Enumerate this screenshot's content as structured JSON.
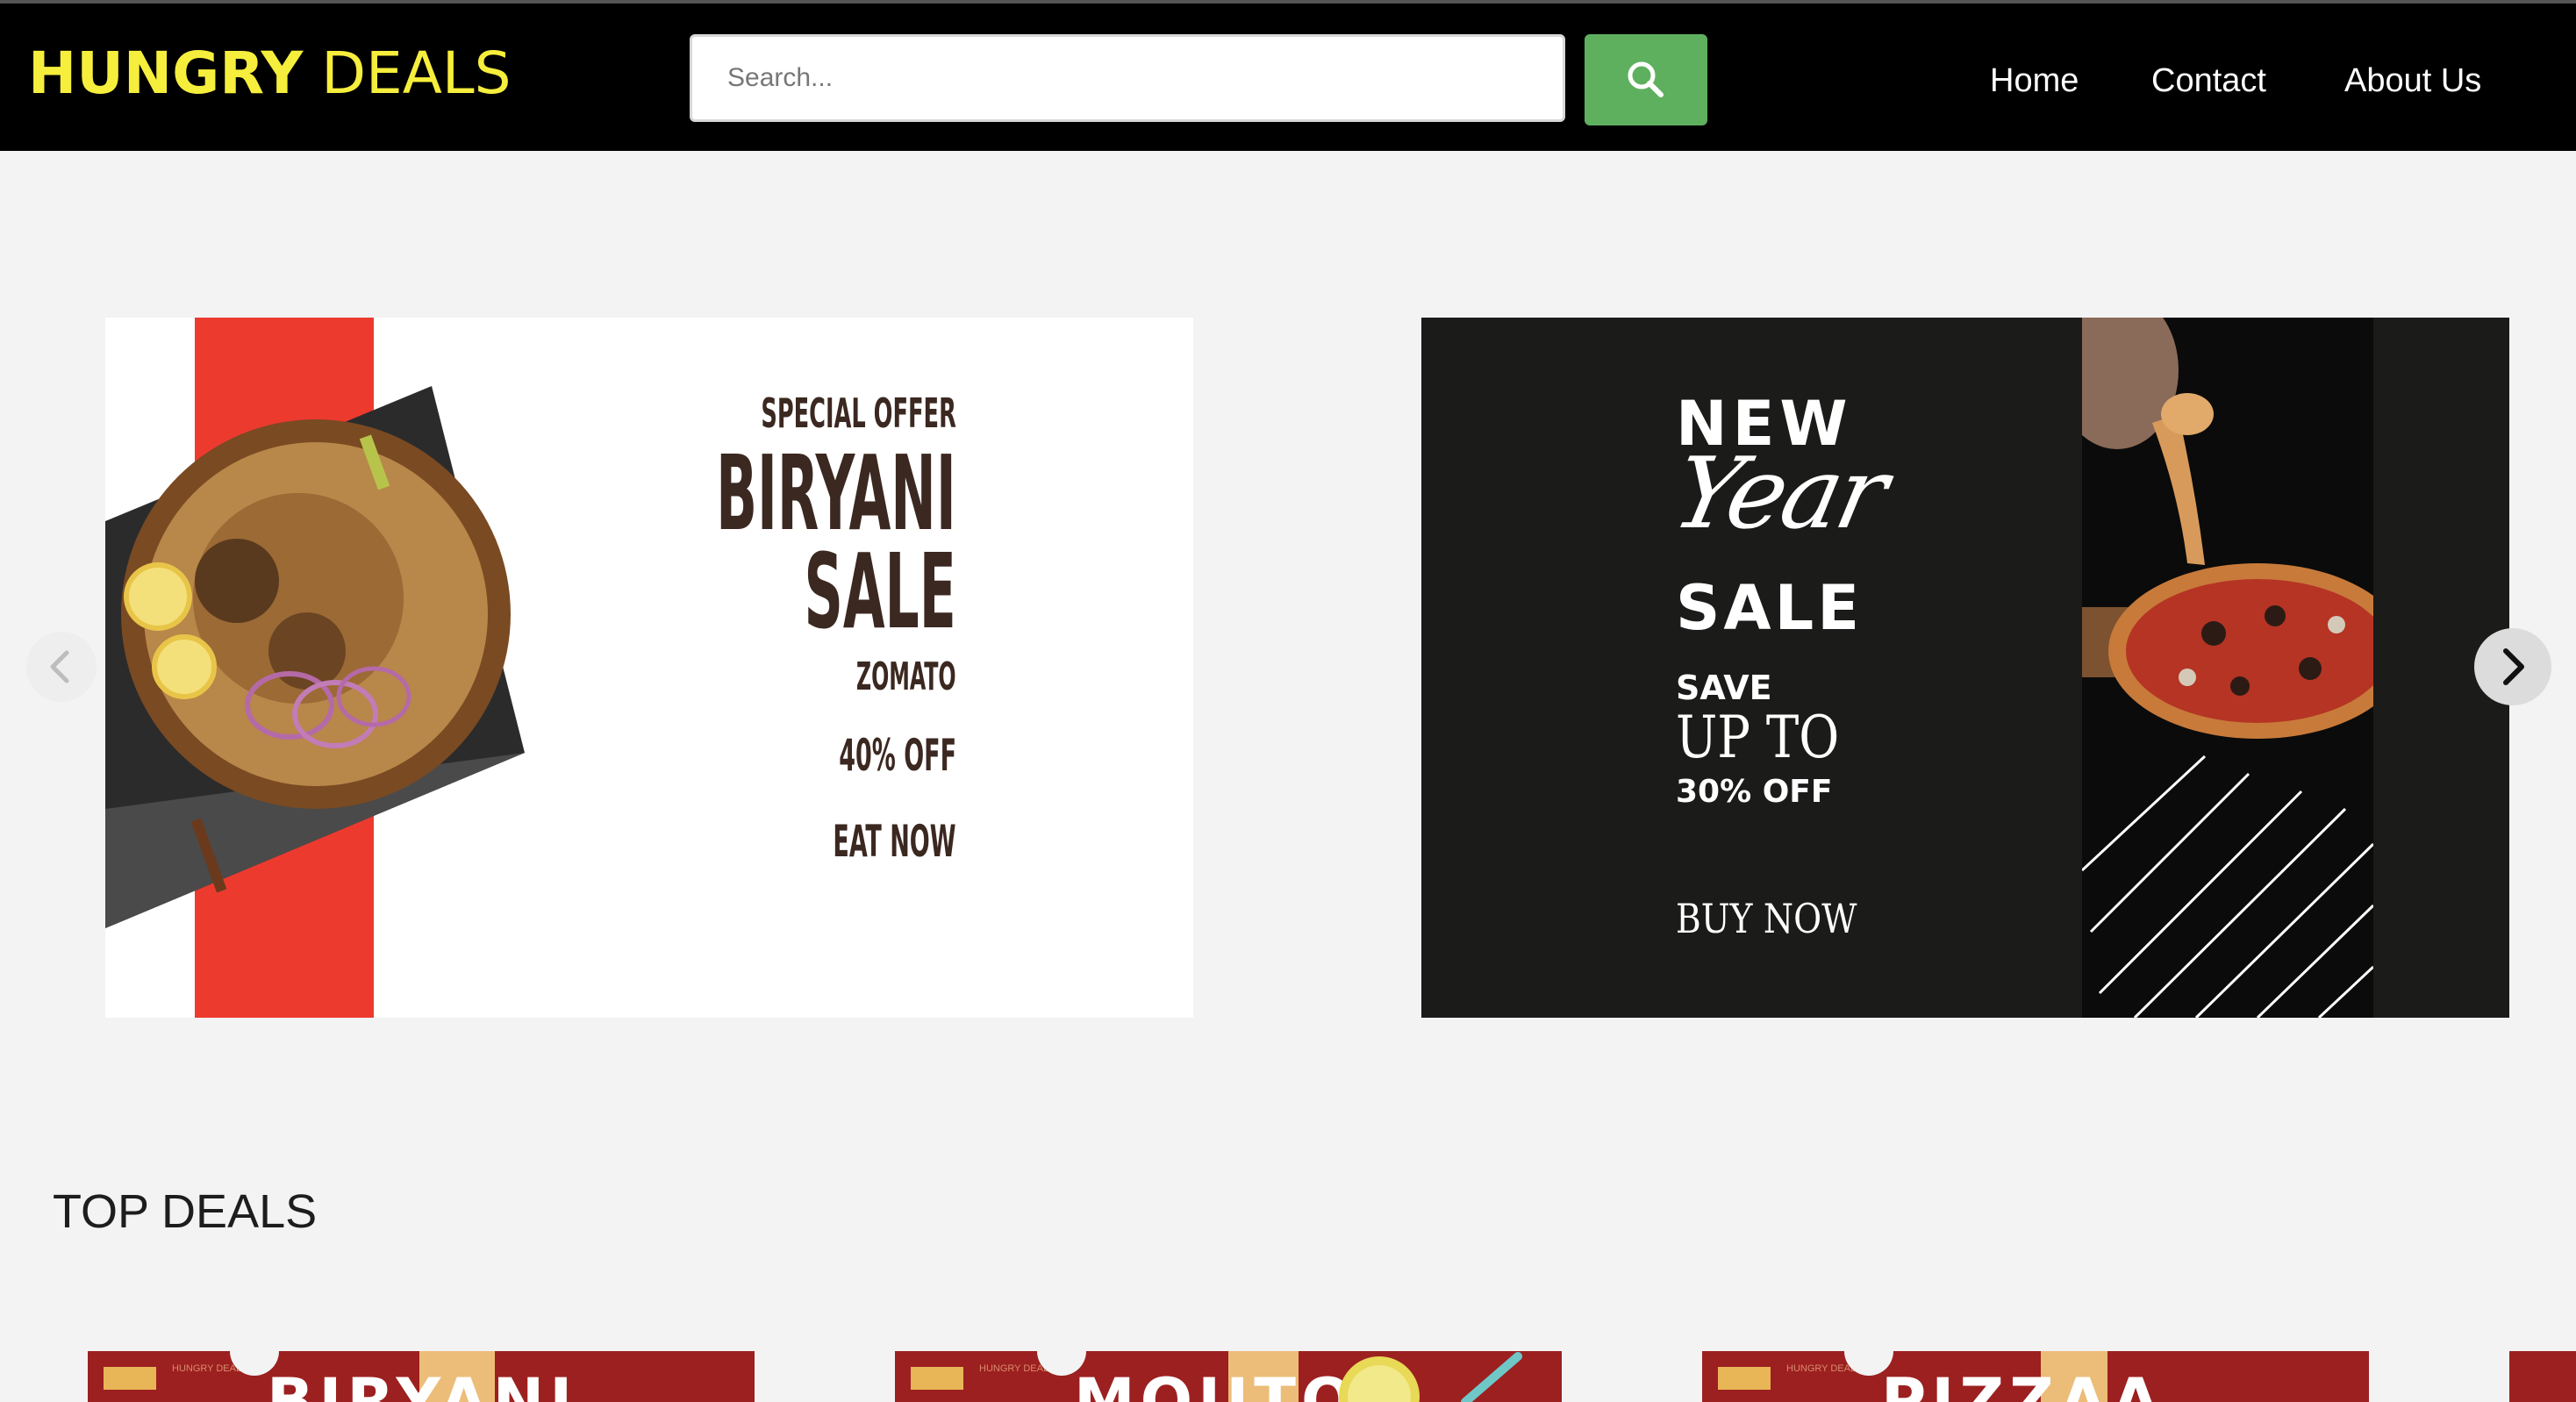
{
  "header": {
    "logo_bold": "HUNGRY",
    "logo_light": "DEALS",
    "search_placeholder": "Search...",
    "search_icon": "search-icon",
    "nav": [
      "Home",
      "Contact",
      "About Us"
    ]
  },
  "carousel": {
    "prev_icon": "chevron-left-icon",
    "next_icon": "chevron-right-icon",
    "slides": [
      {
        "lines": [
          "SPECIAL OFFER",
          "BIRYANI",
          "SALE",
          "ZOMATO",
          "40% OFF",
          "EAT NOW"
        ],
        "accent": "#ec3a2f"
      },
      {
        "lines": [
          "NEW",
          "Year",
          "SALE",
          "SAVE",
          "UP TO",
          "30% OFF",
          "BUY NOW"
        ],
        "background": "#1b1b1a"
      }
    ]
  },
  "top_deals": {
    "title": "TOP DEALS",
    "cards": [
      {
        "brand": "HUNGRY DEALS",
        "title": "BIRYANI"
      },
      {
        "brand": "HUNGRY DEALS",
        "title": "MOJITO"
      },
      {
        "brand": "HUNGRY DEALS",
        "title": "PIZZAA"
      }
    ]
  },
  "colors": {
    "header_bg": "#000000",
    "logo": "#f6ee3c",
    "search_button": "#5fb05e",
    "deal_card": "#9c2020",
    "deal_highlight": "#ecbd78"
  }
}
